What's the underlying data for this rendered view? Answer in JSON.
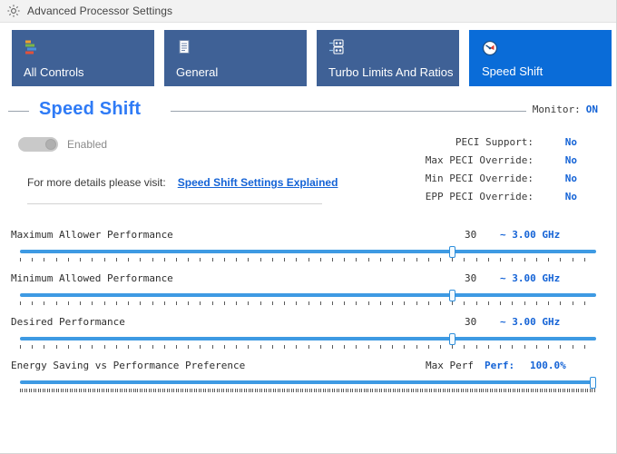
{
  "window": {
    "title": "Advanced Processor Settings",
    "title_icon": "gear-icon"
  },
  "tabs": [
    {
      "label": "All Controls",
      "icon": "sliders-list-icon",
      "selected": false
    },
    {
      "label": "General",
      "icon": "document-icon",
      "selected": false
    },
    {
      "label": "Turbo Limits And Ratios",
      "icon": "numeric-grid-icon",
      "selected": false
    },
    {
      "label": "Speed Shift",
      "icon": "gauge-icon",
      "selected": true
    }
  ],
  "section": {
    "title": "Speed Shift",
    "monitor_label": "Monitor:",
    "monitor_value": "ON"
  },
  "enable": {
    "toggle_label": "Enabled",
    "toggle_state": "off"
  },
  "visit": {
    "prefix": "For more details please visit:",
    "link_text": "Speed Shift Settings Explained"
  },
  "info_rows": [
    {
      "label": "PECI Support:",
      "value": "No"
    },
    {
      "label": "Max PECI Override:",
      "value": "No"
    },
    {
      "label": "Min PECI Override:",
      "value": "No"
    },
    {
      "label": "EPP PECI Override:",
      "value": "No"
    }
  ],
  "sliders": [
    {
      "label": "Maximum Allower Performance",
      "number": "30",
      "freq": "~ 3.00 GHz",
      "percent": 75.3,
      "ticks": 48
    },
    {
      "label": "Minimum Allowed Performance",
      "number": "30",
      "freq": "~ 3.00 GHz",
      "percent": 75.3,
      "ticks": 48
    },
    {
      "label": "Desired Performance",
      "number": "30",
      "freq": "~ 3.00 GHz",
      "percent": 75.3,
      "ticks": 48
    }
  ],
  "energy_slider": {
    "label": "Energy Saving vs Performance Preference",
    "max_perf": "Max Perf",
    "perf_label": "Perf:",
    "perf_value": "100.0%",
    "percent": 100,
    "ticks": 255
  },
  "colors": {
    "tab_inactive": "#3f6196",
    "tab_active": "#0a6cd8",
    "accent_blue": "#1463d6",
    "title_blue": "#2f7bf6",
    "track_blue": "#3e9ae3"
  }
}
